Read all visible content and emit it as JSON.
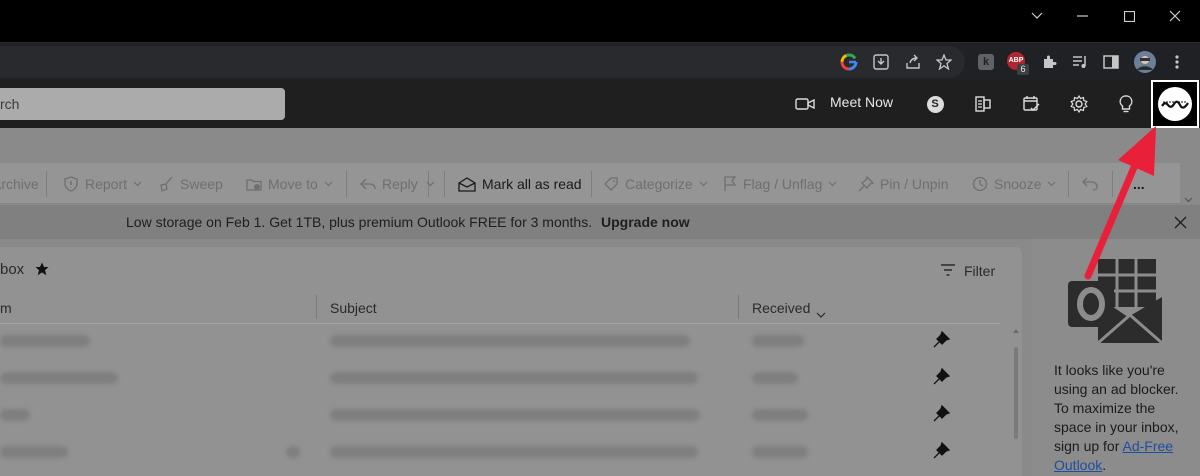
{
  "browser": {
    "extension_badge": {
      "label": "ABP",
      "count": "6"
    }
  },
  "outlook": {
    "search_placeholder": "rch",
    "meet_now": "Meet Now",
    "ribbon": {
      "archive": "Archive",
      "report": "Report",
      "sweep": "Sweep",
      "move_to": "Move to",
      "reply": "Reply",
      "mark_all_read": "Mark all as read",
      "categorize": "Categorize",
      "flag": "Flag / Unflag",
      "pin": "Pin / Unpin",
      "snooze": "Snooze",
      "more": "..."
    },
    "banner": {
      "text": "Low storage on Feb 1. Get 1TB, plus premium Outlook FREE for 3 months.",
      "link": "Upgrade now"
    },
    "folder": {
      "title": "box",
      "filter": "Filter"
    },
    "columns": {
      "from": "m",
      "subject": "Subject",
      "received": "Received"
    },
    "rows_count_label": "",
    "ad_panel": {
      "text": "It looks like you're using an ad blocker. To maximize the space in your inbox, sign up for",
      "link": "Ad-Free Outlook",
      "suffix": "."
    }
  },
  "colors": {
    "annotation_arrow": "#e8203a",
    "link": "#1f4e9e"
  }
}
